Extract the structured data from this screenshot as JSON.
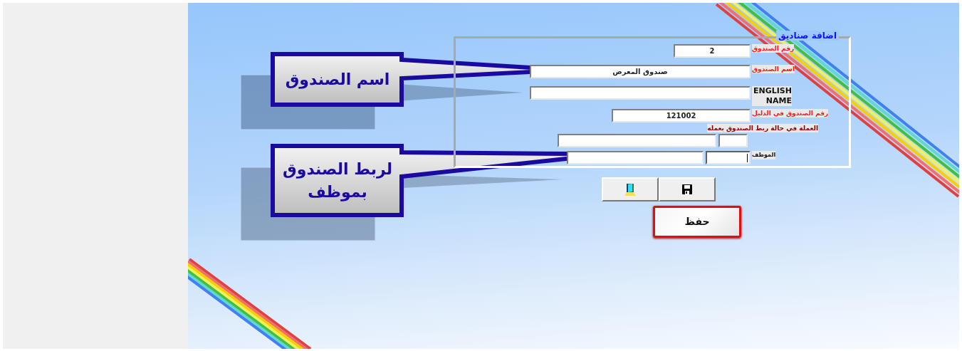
{
  "callouts": [
    {
      "text": "اسم الصندوق"
    },
    {
      "text": "لربط الصندوق بموظف"
    }
  ],
  "form": {
    "legend": "اضافة صناديق",
    "rows": [
      {
        "kind": "required",
        "label": "رقم الصندوق",
        "inputs": [
          {
            "value": "2",
            "focused": false
          }
        ]
      },
      {
        "kind": "required",
        "label": "اسم الصندوق",
        "inputs": [
          {
            "value": "صندوق المعرض",
            "focused": false
          }
        ]
      },
      {
        "kind": "plain",
        "label": "ENGLISH NAME",
        "inputs": [
          {
            "focused": false
          }
        ]
      },
      {
        "kind": "required",
        "label": "رقم الصندوق في الدليل",
        "inputs": [
          {
            "value": "121002",
            "focused": false
          }
        ]
      },
      {
        "kind": "note",
        "label": "العملة في حالة ربط الصندوق بعمله"
      },
      {
        "kind": "inputs",
        "inputs": [
          {
            "focused": false
          },
          {
            "focused": false
          }
        ]
      },
      {
        "kind": "small",
        "label": "الموظف",
        "inputs": [
          {
            "focused": true
          },
          {
            "focused": false
          }
        ]
      }
    ]
  },
  "buttons": [
    {
      "kind": "save-icon"
    },
    {
      "kind": "exit-icon"
    }
  ],
  "save_button": {
    "label": "حفظ"
  }
}
